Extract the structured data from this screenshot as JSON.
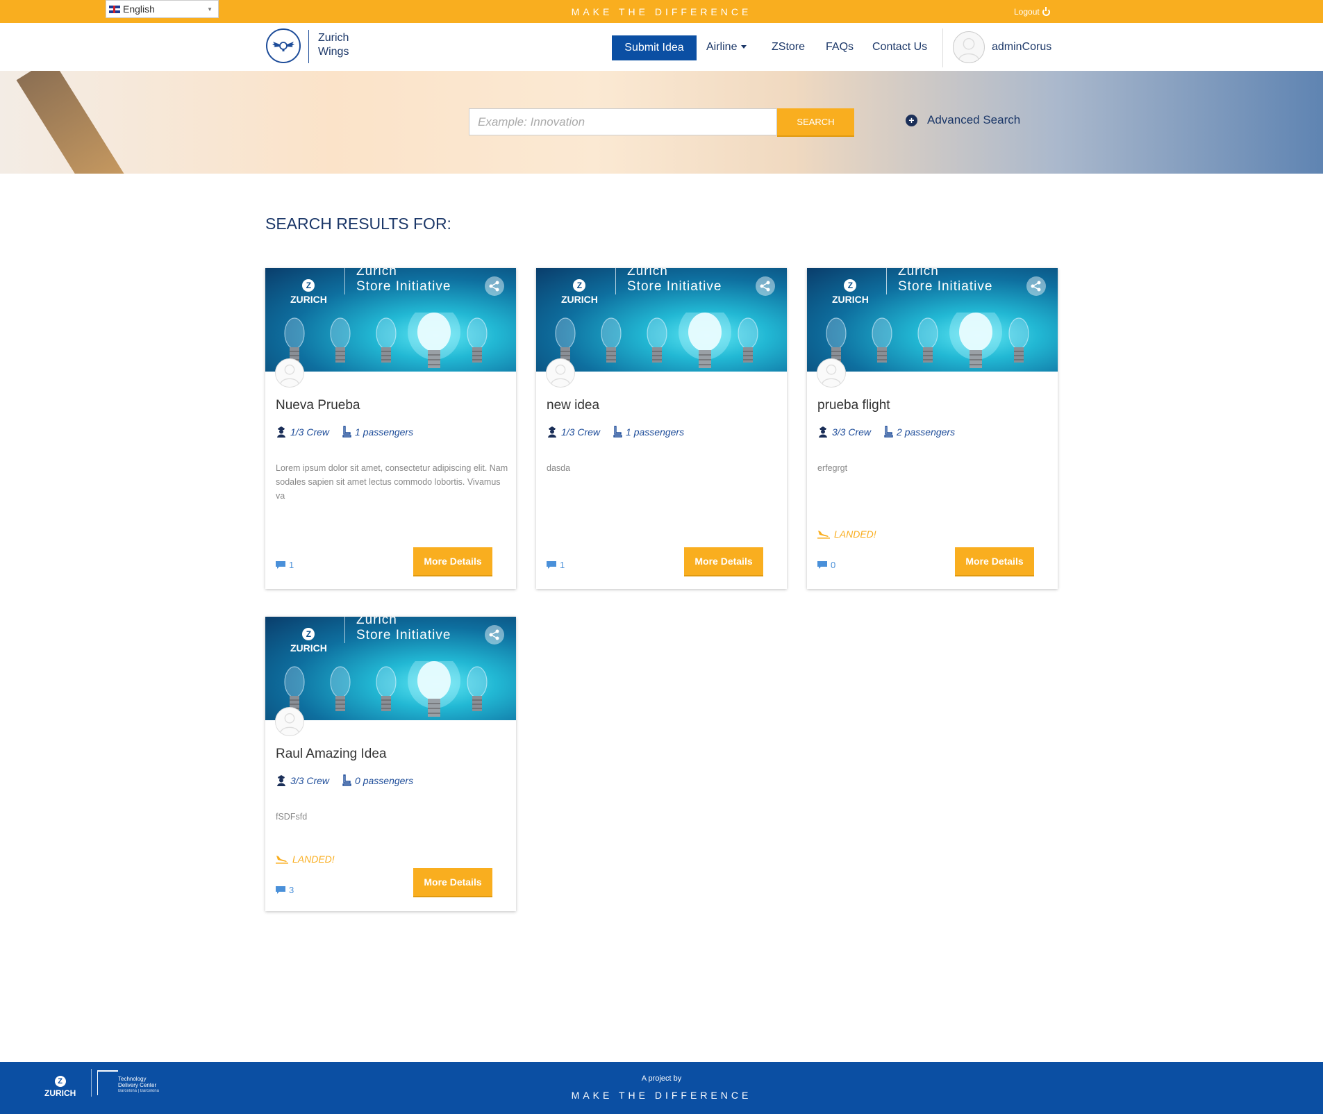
{
  "topbar": {
    "language": "English",
    "tagline": "MAKE THE DIFFERENCE",
    "logout_label": "Logout"
  },
  "navbar": {
    "brand_line1": "Zurich",
    "brand_line2": "Wings",
    "submit_label": "Submit Idea",
    "airline_label": "Airline",
    "zstore_label": "ZStore",
    "faqs_label": "FAQs",
    "contact_label": "Contact Us",
    "username": "adminCorus"
  },
  "search": {
    "placeholder": "Example: Innovation",
    "button_label": "SEARCH",
    "advanced_label": "Advanced Search"
  },
  "results": {
    "title": "SEARCH RESULTS FOR:",
    "image_brand": "ZURICH",
    "image_title_line1": "Zurich",
    "image_title_line2": "Store Initiative",
    "more_label": "More Details",
    "cards": [
      {
        "title": "Nueva Prueba",
        "crew": "1/3 Crew",
        "passengers": "1 passengers",
        "description": "Lorem ipsum dolor sit amet, consectetur adipiscing elit. Nam sodales sapien sit amet lectus commodo lobortis. Vivamus va",
        "landed": "",
        "comments": "1"
      },
      {
        "title": "new idea",
        "crew": "1/3 Crew",
        "passengers": "1 passengers",
        "description": "dasda",
        "landed": "",
        "comments": "1"
      },
      {
        "title": "prueba flight",
        "crew": "3/3 Crew",
        "passengers": "2 passengers",
        "description": "erfegrgt",
        "landed": "LANDED!",
        "comments": "0"
      },
      {
        "title": "Raul Amazing Idea",
        "crew": "3/3 Crew",
        "passengers": "0 passengers",
        "description": "fSDFsfd",
        "landed": "LANDED!",
        "comments": "3"
      }
    ]
  },
  "footer": {
    "brand": "ZURICH",
    "tdc_line1": "Technology",
    "tdc_line2": "Delivery Center",
    "tdc_line3": "Barcelona | Barcelona",
    "project_by": "A project by",
    "tagline": "MAKE THE DIFFERENCE"
  },
  "colors": {
    "accent": "#f9ae1f",
    "primary": "#0b4fa3",
    "navy_text": "#1b3768"
  }
}
